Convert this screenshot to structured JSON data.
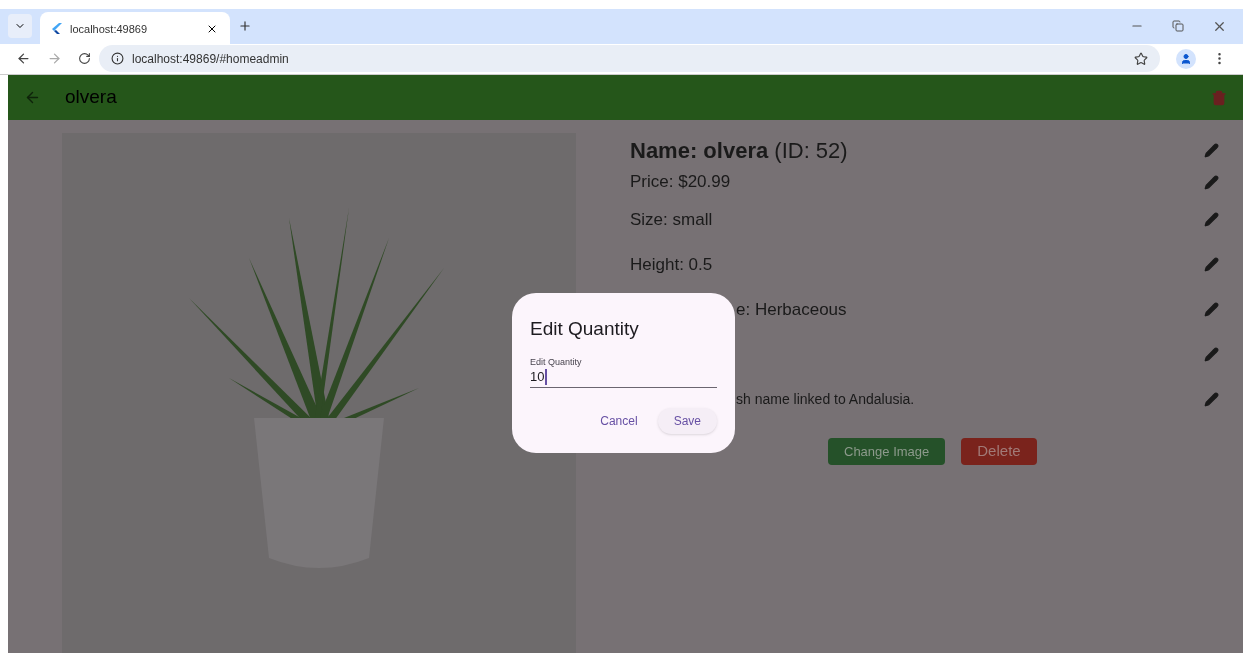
{
  "browser": {
    "tab_title": "localhost:49869",
    "url": "localhost:49869/#homeadmin"
  },
  "app_bar": {
    "title": "olvera"
  },
  "details": {
    "heading": "**Name: olvera** (ID: 52)",
    "rows": [
      {
        "kind": "full",
        "text": "Price: $20.99"
      },
      {
        "kind": "full",
        "text": "Size: small"
      },
      {
        "kind": "full",
        "text": "Height: 0.5"
      },
      {
        "kind": "covered",
        "text": "e: Herbaceous"
      },
      {
        "kind": "hidden"
      },
      {
        "kind": "note",
        "text": "sh name linked to Andalusia."
      }
    ]
  },
  "buttons": {
    "change_image": "Change Image",
    "delete": "Delete"
  },
  "dialog": {
    "title": "Edit Quantity",
    "field_label": "Edit Quantity",
    "value": "10",
    "cancel": "Cancel",
    "save": "Save"
  }
}
